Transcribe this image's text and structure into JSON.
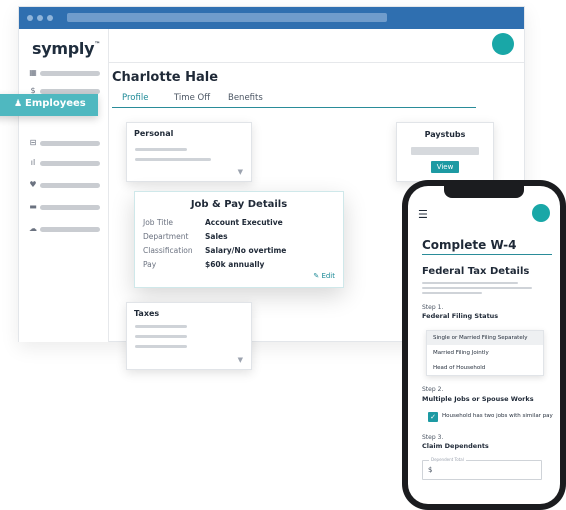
{
  "brand": {
    "name": "symply",
    "mark": "™"
  },
  "nav": {
    "active_label": "Employees",
    "icons": [
      "dashboard-icon",
      "dollar-icon",
      "user-icon",
      "ticket-icon",
      "bar-chart-icon",
      "heart-icon",
      "monitor-icon",
      "cloud-icon"
    ]
  },
  "profile": {
    "name": "Charlotte Hale",
    "tabs": [
      "Profile",
      "Time Off",
      "Benefits"
    ]
  },
  "cards": {
    "personal_title": "Personal",
    "paystubs_title": "Paystubs",
    "paystubs_button": "View",
    "taxes_title": "Taxes",
    "job_title": "Job & Pay Details",
    "job_rows": [
      {
        "label": "Job Title",
        "value": "Account Executive"
      },
      {
        "label": "Department",
        "value": "Sales"
      },
      {
        "label": "Classification",
        "value": "Salary/No overtime"
      },
      {
        "label": "Pay",
        "value": "$60k annually"
      }
    ],
    "edit_label": "Edit"
  },
  "phone": {
    "title": "Complete W-4",
    "section": "Federal Tax Details",
    "step1_label": "Step 1.",
    "step1_title": "Federal Filing Status",
    "filing_options": [
      "Single or Married Filing Separately",
      "Married Filing Jointly",
      "Head of Household"
    ],
    "step2_label": "Step 2.",
    "step2_title": "Multiple Jobs or Spouse Works",
    "checkbox_label": "Household has two jobs with similar pay",
    "step3_label": "Step 3.",
    "step3_title": "Claim Dependents",
    "dependent_label": "Dependent Total",
    "dependent_value": "$"
  },
  "colors": {
    "accent": "#1d9aa3",
    "titlebar": "#2f6fb0",
    "active_nav": "#4fb8c0"
  }
}
